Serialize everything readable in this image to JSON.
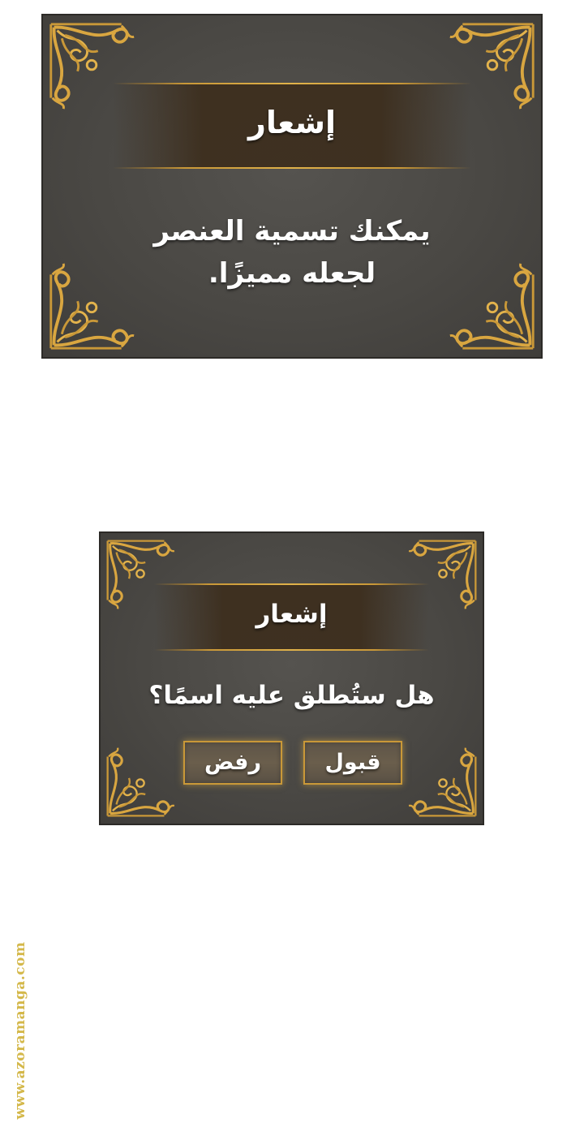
{
  "colors": {
    "panel_bg": "#4a4844",
    "gold": "#c99838",
    "text": "#ffffff",
    "watermark": "#d4b84a"
  },
  "notice1": {
    "title": "إشعار",
    "message_line1": "يمكنك تسمية العنصر",
    "message_line2": "لجعله مميزًا."
  },
  "notice2": {
    "title": "إشعار",
    "question": "هل ستُطلق عليه اسمًا؟",
    "accept_label": "قبول",
    "reject_label": "رفض"
  },
  "watermark": "www.azoramanga.com",
  "icons": [
    "ornate-corner-icon"
  ]
}
